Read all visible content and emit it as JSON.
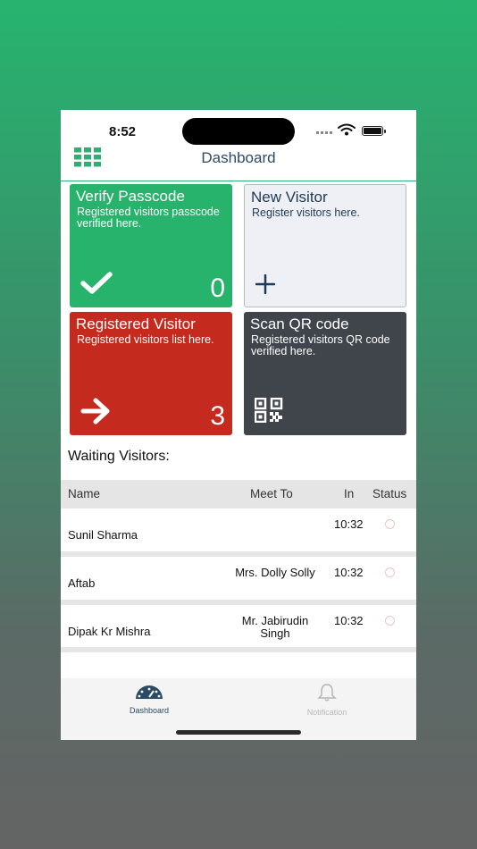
{
  "status_bar": {
    "time": "8:52"
  },
  "nav": {
    "title": "Dashboard"
  },
  "tiles": {
    "verify": {
      "title": "Verify Passcode",
      "desc": "Registered visitors passcode verified here.",
      "count": "0"
    },
    "new_visitor": {
      "title": "New Visitor",
      "desc": "Register visitors here."
    },
    "registered": {
      "title": "Registered Visitor",
      "desc": "Registered visitors list here.",
      "count": "3"
    },
    "scan_qr": {
      "title": "Scan QR code",
      "desc": "Registered visitors QR code verified here."
    }
  },
  "waiting": {
    "heading": "Waiting Visitors:",
    "columns": {
      "name": "Name",
      "meet_to": "Meet To",
      "in": "In",
      "status": "Status"
    },
    "rows": [
      {
        "name": "Sunil Sharma",
        "meet_to": "",
        "in": "10:32"
      },
      {
        "name": "Aftab",
        "meet_to": "Mrs. Dolly Solly",
        "in": "10:32"
      },
      {
        "name": "Dipak Kr Mishra",
        "meet_to": "Mr. Jabirudin Singh",
        "in": "10:32"
      }
    ]
  },
  "tab_bar": {
    "dashboard": {
      "label": "Dashboard",
      "icon": "speedometer-icon"
    },
    "notification": {
      "label": "Notification",
      "icon": "bell-icon"
    }
  },
  "colors": {
    "green": "#27b36c",
    "red": "#c52a1e",
    "dark": "#40454c",
    "navy": "#2c4a63"
  }
}
